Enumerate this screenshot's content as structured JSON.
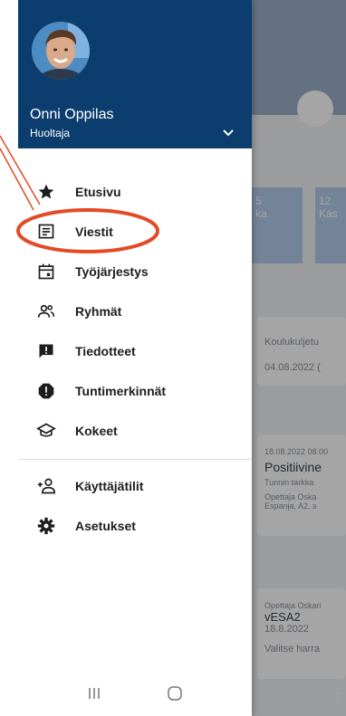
{
  "user": {
    "name": "Onni Oppilas",
    "role": "Huoltaja"
  },
  "menu": {
    "items": [
      {
        "label": "Etusivu",
        "icon": "star-icon"
      },
      {
        "label": "Viestit",
        "icon": "message-icon"
      },
      {
        "label": "Työjärjestys",
        "icon": "calendar-icon"
      },
      {
        "label": "Ryhmät",
        "icon": "group-icon"
      },
      {
        "label": "Tiedotteet",
        "icon": "announcement-icon"
      },
      {
        "label": "Tuntimerkinnät",
        "icon": "alert-icon"
      },
      {
        "label": "Kokeet",
        "icon": "graduation-cap-icon"
      }
    ],
    "secondary": [
      {
        "label": "Käyttäjätilit",
        "icon": "add-user-icon"
      },
      {
        "label": "Asetukset",
        "icon": "gear-icon"
      }
    ]
  },
  "background": {
    "tile1_num": "5",
    "tile1_text": "ka",
    "tile2_num": "12.",
    "tile2_text": "Käs",
    "card1_title": "Koulukuljetu",
    "card1_date": "04.08.2022 (",
    "card2_time": "18.08.2022 08.00",
    "card2_title": "Positiivine",
    "card2_sub": "Tunnin tarkka",
    "card2_teacher": "Opettaja Oska",
    "card2_subject": "Espanja, A2, s",
    "card3_teacher": "Opettaja Oskari",
    "card3_title": "vESA2",
    "card3_date": "18.8.2022",
    "card3_action": "Valitse harra"
  },
  "colors": {
    "drawer_header": "#0b3d6e",
    "highlight": "#e34a25"
  }
}
